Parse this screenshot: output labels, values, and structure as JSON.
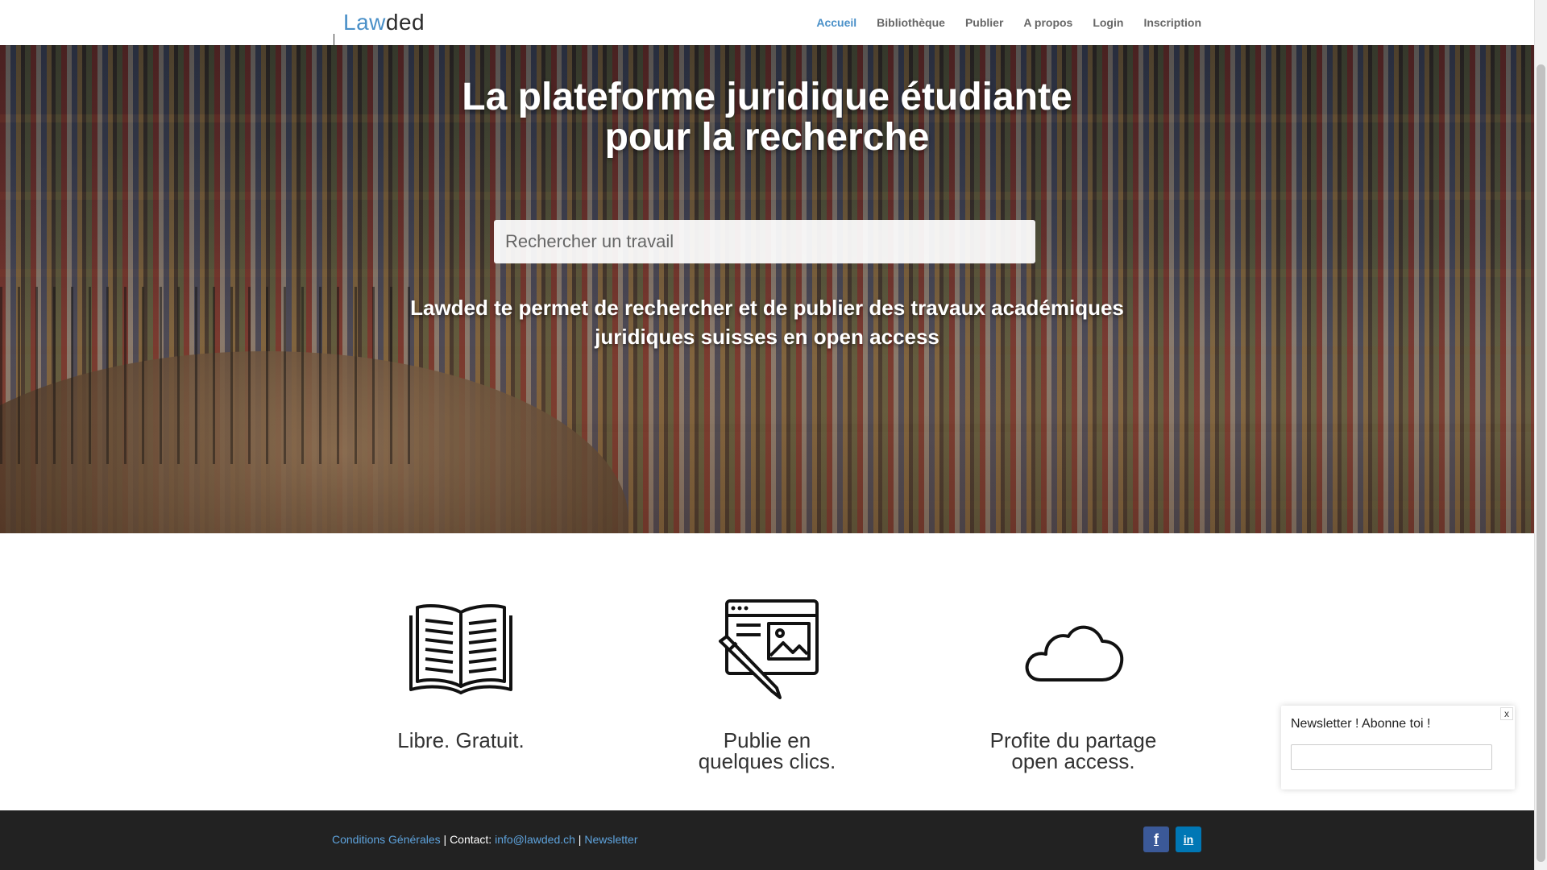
{
  "header": {
    "logo_part1": "Law",
    "logo_part2": "ded",
    "nav": [
      "Accueil",
      "Bibliothèque",
      "Publier",
      "A propos",
      "Login",
      "Inscription"
    ],
    "active_nav": "Accueil"
  },
  "hero": {
    "title_line1": "La plateforme juridique étudiante",
    "title_line2": "pour la recherche",
    "search_placeholder": "Rechercher un travail",
    "subtitle_line1": "Lawded te permet de rechercher et de publier des travaux académiques",
    "subtitle_line2": "juridiques suisses en open access"
  },
  "features": [
    {
      "icon": "open-book-icon",
      "label": "Libre. Gratuit."
    },
    {
      "icon": "webpage-pen-icon",
      "label": "Publie en\nquelques clics."
    },
    {
      "icon": "cloud-icon",
      "label": "Profite du partage\nopen access."
    }
  ],
  "newsletter_popup": {
    "title": "Newsletter ! Abonne toi !",
    "close_label": "x"
  },
  "footer": {
    "terms_link": "Conditions Générales",
    "separator1": " | ",
    "contact_label": "Contact: ",
    "email_link": "info@lawded.ch",
    "separator2": " | ",
    "newsletter_link": "Newsletter",
    "social": {
      "facebook": "f",
      "linkedin": "in"
    }
  },
  "colors": {
    "accent": "#4a90c8",
    "footer_bg": "#222222",
    "facebook": "#3b5998",
    "linkedin": "#0077b5"
  }
}
